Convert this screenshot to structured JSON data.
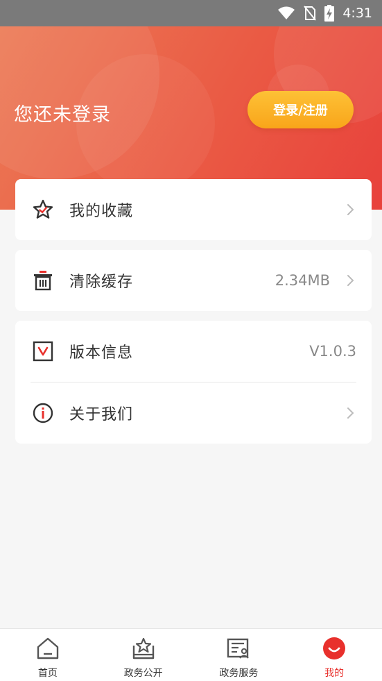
{
  "status_bar": {
    "time": "4:31"
  },
  "header": {
    "login_prompt": "您还未登录",
    "login_button": "登录/注册"
  },
  "menu": {
    "favorites": {
      "label": "我的收藏"
    },
    "clear_cache": {
      "label": "清除缓存",
      "value": "2.34MB"
    },
    "version": {
      "label": "版本信息",
      "value": "V1.0.3"
    },
    "about": {
      "label": "关于我们"
    }
  },
  "tabbar": {
    "tabs": [
      {
        "label": "首页",
        "icon": "home-icon"
      },
      {
        "label": "政务公开",
        "icon": "star-house-icon"
      },
      {
        "label": "政务服务",
        "icon": "service-card-icon"
      },
      {
        "label": "我的",
        "icon": "smile-icon"
      }
    ],
    "active_index": 3
  },
  "colors": {
    "accent": "#e8302c",
    "button_orange": "#fbb02a",
    "header_start": "#ec7b56",
    "header_end": "#e8413b"
  }
}
